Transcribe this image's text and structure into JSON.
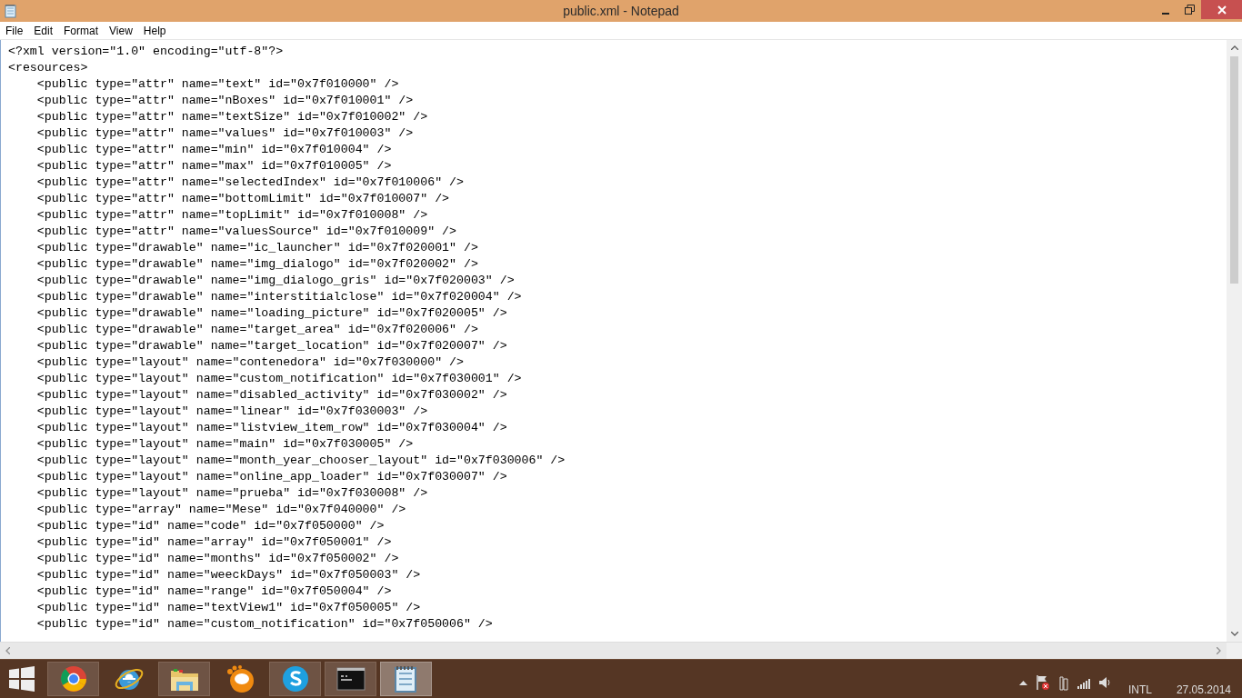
{
  "window": {
    "title": "public.xml - Notepad"
  },
  "menu": [
    "File",
    "Edit",
    "Format",
    "View",
    "Help"
  ],
  "editor": {
    "lines": [
      "<?xml version=\"1.0\" encoding=\"utf-8\"?>",
      "<resources>",
      "    <public type=\"attr\" name=\"text\" id=\"0x7f010000\" />",
      "    <public type=\"attr\" name=\"nBoxes\" id=\"0x7f010001\" />",
      "    <public type=\"attr\" name=\"textSize\" id=\"0x7f010002\" />",
      "    <public type=\"attr\" name=\"values\" id=\"0x7f010003\" />",
      "    <public type=\"attr\" name=\"min\" id=\"0x7f010004\" />",
      "    <public type=\"attr\" name=\"max\" id=\"0x7f010005\" />",
      "    <public type=\"attr\" name=\"selectedIndex\" id=\"0x7f010006\" />",
      "    <public type=\"attr\" name=\"bottomLimit\" id=\"0x7f010007\" />",
      "    <public type=\"attr\" name=\"topLimit\" id=\"0x7f010008\" />",
      "    <public type=\"attr\" name=\"valuesSource\" id=\"0x7f010009\" />",
      "    <public type=\"drawable\" name=\"ic_launcher\" id=\"0x7f020001\" />",
      "    <public type=\"drawable\" name=\"img_dialogo\" id=\"0x7f020002\" />",
      "    <public type=\"drawable\" name=\"img_dialogo_gris\" id=\"0x7f020003\" />",
      "    <public type=\"drawable\" name=\"interstitialclose\" id=\"0x7f020004\" />",
      "    <public type=\"drawable\" name=\"loading_picture\" id=\"0x7f020005\" />",
      "    <public type=\"drawable\" name=\"target_area\" id=\"0x7f020006\" />",
      "    <public type=\"drawable\" name=\"target_location\" id=\"0x7f020007\" />",
      "    <public type=\"layout\" name=\"contenedora\" id=\"0x7f030000\" />",
      "    <public type=\"layout\" name=\"custom_notification\" id=\"0x7f030001\" />",
      "    <public type=\"layout\" name=\"disabled_activity\" id=\"0x7f030002\" />",
      "    <public type=\"layout\" name=\"linear\" id=\"0x7f030003\" />",
      "    <public type=\"layout\" name=\"listview_item_row\" id=\"0x7f030004\" />",
      "    <public type=\"layout\" name=\"main\" id=\"0x7f030005\" />",
      "    <public type=\"layout\" name=\"month_year_chooser_layout\" id=\"0x7f030006\" />",
      "    <public type=\"layout\" name=\"online_app_loader\" id=\"0x7f030007\" />",
      "    <public type=\"layout\" name=\"prueba\" id=\"0x7f030008\" />",
      "    <public type=\"array\" name=\"Mese\" id=\"0x7f040000\" />",
      "    <public type=\"id\" name=\"code\" id=\"0x7f050000\" />",
      "    <public type=\"id\" name=\"array\" id=\"0x7f050001\" />",
      "    <public type=\"id\" name=\"months\" id=\"0x7f050002\" />",
      "    <public type=\"id\" name=\"weeckDays\" id=\"0x7f050003\" />",
      "    <public type=\"id\" name=\"range\" id=\"0x7f050004\" />",
      "    <public type=\"id\" name=\"textView1\" id=\"0x7f050005\" />",
      "    <public type=\"id\" name=\"custom_notification\" id=\"0x7f050006\" />"
    ]
  },
  "taskbar": {
    "apps": [
      {
        "kind": "browser",
        "running": true,
        "selected": false
      },
      {
        "kind": "e-browser",
        "running": false,
        "selected": false
      },
      {
        "kind": "folder",
        "running": true,
        "selected": false
      },
      {
        "kind": "orange",
        "running": false,
        "selected": false
      },
      {
        "kind": "chat",
        "running": true,
        "selected": false
      },
      {
        "kind": "terminal",
        "running": true,
        "selected": false
      },
      {
        "kind": "notepad",
        "running": true,
        "selected": true
      }
    ],
    "language": "INTL",
    "date": "27.05.2014"
  }
}
